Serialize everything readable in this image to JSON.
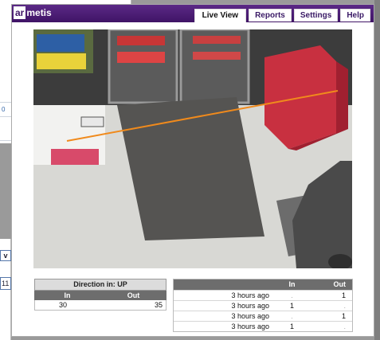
{
  "background": {
    "left_number": "0",
    "partial_tab": "v",
    "partial_cell": "11"
  },
  "header": {
    "logo_highlight": "ar",
    "logo_rest": "metis",
    "tabs": [
      {
        "label": "Live View",
        "active": true
      },
      {
        "label": "Reports",
        "active": false
      },
      {
        "label": "Settings",
        "active": false
      },
      {
        "label": "Help",
        "active": false
      }
    ]
  },
  "colors": {
    "header_purple": "#4a1c74",
    "count_line": "#f08a1c",
    "table_header": "#6d6d6d"
  },
  "summary": {
    "title": "Direction in: UP",
    "col_in": "In",
    "col_out": "Out",
    "in_value": "30",
    "out_value": "35"
  },
  "events": {
    "col_time": "",
    "col_in": "In",
    "col_out": "Out",
    "rows": [
      {
        "time": "3 hours ago",
        "in": ".",
        "out": "1"
      },
      {
        "time": "3 hours ago",
        "in": "1",
        "out": "."
      },
      {
        "time": "3 hours ago",
        "in": ".",
        "out": "1"
      },
      {
        "time": "3 hours ago",
        "in": "1",
        "out": "."
      }
    ]
  }
}
